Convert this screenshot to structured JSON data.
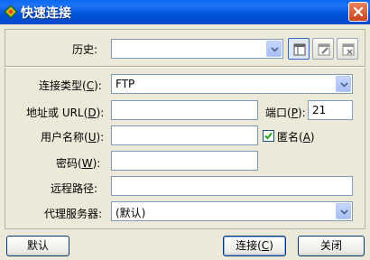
{
  "window": {
    "title": "快速连接"
  },
  "history": {
    "label": "历史:",
    "value": ""
  },
  "connection_type": {
    "label_prefix": "连接类型(",
    "label_key": "C",
    "label_suffix": "):",
    "value": "FTP"
  },
  "address": {
    "label_prefix": "地址或 URL(",
    "label_key": "D",
    "label_suffix": "):",
    "value": ""
  },
  "port": {
    "label_prefix": "端口(",
    "label_key": "P",
    "label_suffix": "):",
    "value": "21"
  },
  "username": {
    "label_prefix": "用户名称(",
    "label_key": "U",
    "label_suffix": "):",
    "value": ""
  },
  "anonymous": {
    "label_prefix": "匿名(",
    "label_key": "A",
    "label_suffix": ")",
    "checked": true
  },
  "password": {
    "label_prefix": "密码(",
    "label_key": "W",
    "label_suffix": "):",
    "value": ""
  },
  "remote_path": {
    "label": "远程路径:",
    "value": ""
  },
  "proxy": {
    "label": "代理服务器:",
    "value": "(默认)"
  },
  "buttons": {
    "default": "默认",
    "connect_prefix": "连接(",
    "connect_key": "C",
    "connect_suffix": ")",
    "close": "关闭"
  },
  "icons": {
    "app": "app-diamond-icon",
    "close": "close-x-icon",
    "dropdown": "chevron-down-icon",
    "tool1": "panel-layout-icon",
    "tool2": "panel-edit-icon",
    "tool3": "panel-delete-icon",
    "check": "checkmark-icon"
  },
  "colors": {
    "titlebar": "#0052d6",
    "dialog_bg": "#ece9d8",
    "field_border": "#7f9db9",
    "check": "#21a121"
  }
}
